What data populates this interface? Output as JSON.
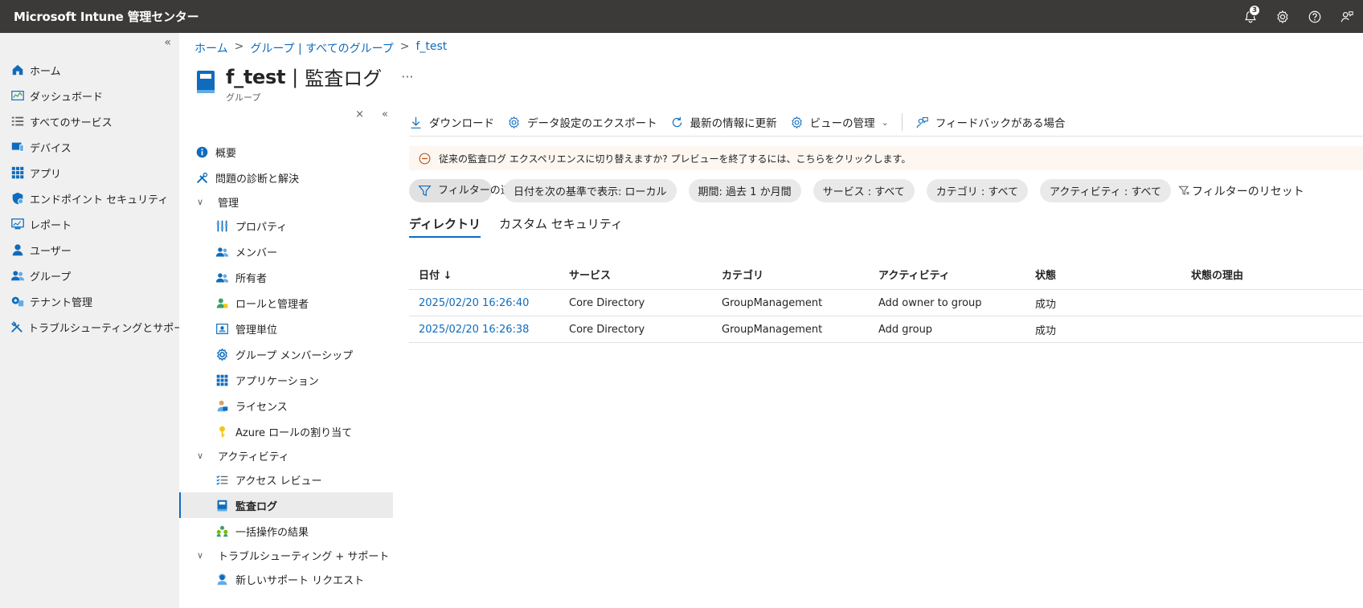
{
  "topbar": {
    "app_title": "Microsoft Intune 管理センター",
    "notification_count": "3"
  },
  "leftnav": {
    "collapse": "«",
    "items": [
      {
        "label": "ホーム",
        "icon": "home-icon"
      },
      {
        "label": "ダッシュボード",
        "icon": "dashboard-icon"
      },
      {
        "label": "すべてのサービス",
        "icon": "list-icon"
      },
      {
        "label": "デバイス",
        "icon": "devices-icon"
      },
      {
        "label": "アプリ",
        "icon": "apps-icon"
      },
      {
        "label": "エンドポイント セキュリティ",
        "icon": "shield-icon"
      },
      {
        "label": "レポート",
        "icon": "reports-icon"
      },
      {
        "label": "ユーザー",
        "icon": "user-icon"
      },
      {
        "label": "グループ",
        "icon": "group-icon"
      },
      {
        "label": "テナント管理",
        "icon": "tenant-icon"
      },
      {
        "label": "トラブルシューティングとサポート",
        "icon": "tools-icon"
      }
    ]
  },
  "breadcrumb": {
    "home": "ホーム",
    "sep": ">",
    "groups": "グループ | すべてのグループ",
    "current": "f_test"
  },
  "header": {
    "title": "f_test",
    "separator": "|",
    "section": "監査ログ",
    "more": "···",
    "kind": "グループ"
  },
  "resmenu": {
    "close": "×",
    "collapse": "«",
    "overview": "概要",
    "diagnose": "問題の診断と解決",
    "manage": "管理",
    "properties": "プロパティ",
    "members": "メンバー",
    "owners": "所有者",
    "roles": "ロールと管理者",
    "admin_units": "管理単位",
    "membership": "グループ メンバーシップ",
    "applications": "アプリケーション",
    "licenses": "ライセンス",
    "azure_roles": "Azure ロールの割り当て",
    "activity": "アクティビティ",
    "access_reviews": "アクセス レビュー",
    "audit_logs": "監査ログ",
    "bulk_results": "一括操作の結果",
    "troubleshoot": "トラブルシューティング + サポート",
    "new_support": "新しいサポート リクエスト"
  },
  "cmdbar": {
    "download": "ダウンロード",
    "export": "データ設定のエクスポート",
    "refresh": "最新の情報に更新",
    "manage_view": "ビューの管理",
    "chevron": "⌄",
    "feedback": "フィードバックがある場合"
  },
  "banner": {
    "text": "従来の監査ログ エクスペリエンスに切り替えますか? プレビューを終了するには、こちらをクリックします。"
  },
  "filters": {
    "add_filter": "フィルターの追加",
    "date_display": "日付を次の基準で表示: ローカル",
    "period": "期間: 過去 1 か月間",
    "service": "サービス : すべて",
    "category": "カテゴリ : すべて",
    "activity": "アクティビティ : すべて",
    "reset": "フィルターのリセット"
  },
  "tabs": {
    "directory": "ディレクトリ",
    "custom_security": "カスタム セキュリティ"
  },
  "table": {
    "columns": [
      "日付 ↓",
      "サービス",
      "カテゴリ",
      "アクティビティ",
      "状態",
      "状態の理由"
    ],
    "rows": [
      {
        "date": "2025/02/20 16:26:40",
        "service": "Core Directory",
        "category": "GroupManagement",
        "activity": "Add owner to group",
        "status": "成功",
        "reason": ""
      },
      {
        "date": "2025/02/20 16:26:38",
        "service": "Core Directory",
        "category": "GroupManagement",
        "activity": "Add group",
        "status": "成功",
        "reason": ""
      }
    ]
  },
  "colors": {
    "topbar": "#3b3a39",
    "accent": "#0f6cbd",
    "nav_bg": "#f0f0f0",
    "banner_bg": "#fdf6f1",
    "banner_icon": "#bc4b09"
  }
}
